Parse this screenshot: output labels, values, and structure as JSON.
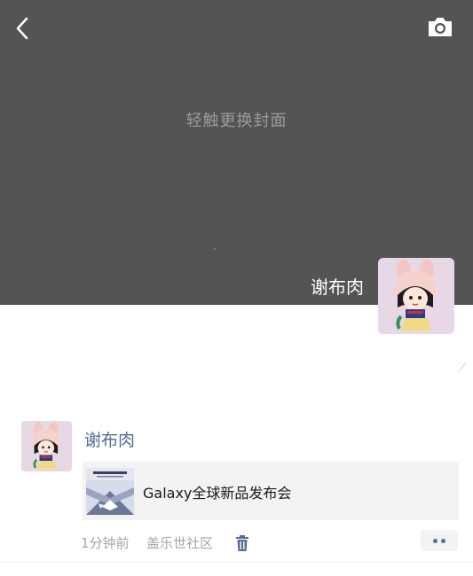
{
  "cover": {
    "hint": "轻触更换封面",
    "background": "#545454"
  },
  "nav": {
    "back_icon": "back-chevron-icon",
    "camera_icon": "camera-icon"
  },
  "profile": {
    "name": "谢布肉",
    "avatar": "cartoon-girl-bunny-hat-avatar"
  },
  "post": {
    "author": "谢布肉",
    "share": {
      "title": "Galaxy全球新品发布会",
      "thumb_title": "Galaxy全球新品发布会",
      "thumb_icon": "galaxy-launch-thumbnail"
    },
    "time": "1分钟前",
    "location": "盖乐世社区",
    "delete_icon": "trash-icon",
    "more_icon": "more-dots-icon"
  },
  "colors": {
    "link": "#576b95",
    "meta": "#a5a5a5",
    "card_bg": "#f3f3f3"
  }
}
